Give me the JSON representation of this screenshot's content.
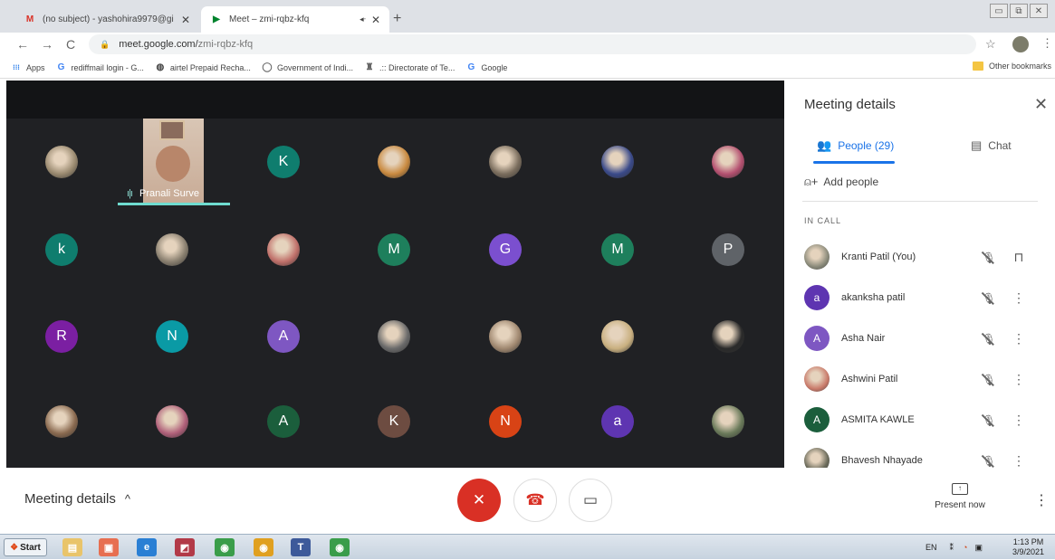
{
  "browser": {
    "tabs": [
      {
        "icon": "gmail-icon",
        "icon_glyph": "M",
        "title": "(no subject) - yashohira9979@gi",
        "close": "✕"
      },
      {
        "icon": "meet-icon",
        "icon_glyph": "▶",
        "title": "Meet – zmi-rqbz-kfq",
        "audio": "◂ᐧ",
        "close": "✕"
      }
    ],
    "new_tab": "+",
    "window_controls": [
      "▭",
      "⧉",
      "✕"
    ],
    "nav": {
      "back": "←",
      "forward": "→",
      "reload": "C"
    },
    "url": {
      "lock": "🔒",
      "host": "meet.google.com/",
      "path": "zmi-rqbz-kfq"
    },
    "star": "☆",
    "menu": "⋮",
    "bookmarks": [
      {
        "icon": "apps-icon",
        "glyph": "⁝⁝⁝",
        "label": "Apps"
      },
      {
        "icon": "google-icon",
        "glyph": "G",
        "label": "rediffmail login - G..."
      },
      {
        "icon": "globe-icon",
        "glyph": "◍",
        "label": "airtel Prepaid Recha..."
      },
      {
        "icon": "globe-icon",
        "glyph": "◯",
        "label": "Government of Indi..."
      },
      {
        "icon": "emblem-icon",
        "glyph": "♜",
        "label": ".:: Directorate of Te..."
      },
      {
        "icon": "google-icon",
        "glyph": "G",
        "label": "Google"
      }
    ],
    "other_bookmarks": "Other bookmarks"
  },
  "stage": {
    "speaker": {
      "name": "Pranali Surve",
      "bars": "ı|ı"
    },
    "tiles": [
      {
        "type": "photo",
        "name": "participant-photo"
      },
      {
        "type": "letter",
        "letter": "K",
        "color": "#0f7d6e"
      },
      {
        "type": "photo"
      },
      {
        "type": "photo"
      },
      {
        "type": "photo"
      },
      {
        "type": "photo"
      },
      {
        "type": "letter",
        "letter": "k",
        "color": "#0f7d6e"
      },
      {
        "type": "photo"
      },
      {
        "type": "photo"
      },
      {
        "type": "letter",
        "letter": "M",
        "color": "#1e7f5c"
      },
      {
        "type": "letter",
        "letter": "G",
        "color": "#7b4fcf"
      },
      {
        "type": "letter",
        "letter": "M",
        "color": "#1e7f5c"
      },
      {
        "type": "letter",
        "letter": "P",
        "color": "#5f6368"
      },
      {
        "type": "letter",
        "letter": "R",
        "color": "#7b1fa2"
      },
      {
        "type": "letter",
        "letter": "N",
        "color": "#0a9aa5"
      },
      {
        "type": "letter",
        "letter": "A",
        "color": "#7e57c2"
      },
      {
        "type": "photo"
      },
      {
        "type": "photo"
      },
      {
        "type": "photo"
      },
      {
        "type": "photo"
      },
      {
        "type": "photo"
      },
      {
        "type": "photo"
      },
      {
        "type": "letter",
        "letter": "A",
        "color": "#1b5e3c"
      },
      {
        "type": "letter",
        "letter": "K",
        "color": "#6d4c41"
      },
      {
        "type": "letter",
        "letter": "N",
        "color": "#d84315"
      },
      {
        "type": "letter",
        "letter": "a",
        "color": "#5e35b1"
      },
      {
        "type": "photo"
      }
    ]
  },
  "panel": {
    "title": "Meeting details",
    "close": "✕",
    "tab_people": "People (29)",
    "tab_chat": "Chat",
    "add_people": "Add people",
    "in_call": "IN CALL",
    "people": [
      {
        "name": "Kranti Patil (You)",
        "avatar": "",
        "color": "#8a8a7a",
        "mic": "🎙",
        "action": "⊓"
      },
      {
        "name": "akanksha patil",
        "avatar": "a",
        "color": "#5e35b1",
        "mic": "🎙",
        "action": "⋮"
      },
      {
        "name": "Asha Nair",
        "avatar": "A",
        "color": "#7e57c2",
        "mic": "🎙",
        "action": "⋮"
      },
      {
        "name": "Ashwini Patil",
        "avatar": "",
        "color": "#c97a6a",
        "mic": "🎙",
        "action": "⋮"
      },
      {
        "name": "ASMITA KAWLE",
        "avatar": "A",
        "color": "#1b5e3c",
        "mic": "🎙",
        "action": "⋮"
      },
      {
        "name": "Bhavesh Nhayade",
        "avatar": "",
        "color": "#6a6a5a",
        "mic": "🎙",
        "action": "⋮"
      }
    ]
  },
  "bottom": {
    "meeting_details": "Meeting details",
    "chevron": "^",
    "present_now": "Present now",
    "more": "⋮"
  },
  "taskbar": {
    "start": "Start",
    "apps": [
      {
        "name": "folder",
        "color": "#e9c46a",
        "glyph": "▤"
      },
      {
        "name": "media",
        "color": "#e76f51",
        "glyph": "▣"
      },
      {
        "name": "ie",
        "color": "#2a7fd4",
        "glyph": "e"
      },
      {
        "name": "paint",
        "color": "#b23a48",
        "glyph": "◩"
      },
      {
        "name": "chrome1",
        "color": "#3a9d4a",
        "glyph": "◉"
      },
      {
        "name": "chrome2",
        "color": "#e0a020",
        "glyph": "◉"
      },
      {
        "name": "teams",
        "color": "#3d5a9a",
        "glyph": "T"
      },
      {
        "name": "chrome3",
        "color": "#3a9d4a",
        "glyph": "◉"
      }
    ],
    "lang": "EN",
    "time": "1:13 PM",
    "date": "3/9/2021"
  }
}
